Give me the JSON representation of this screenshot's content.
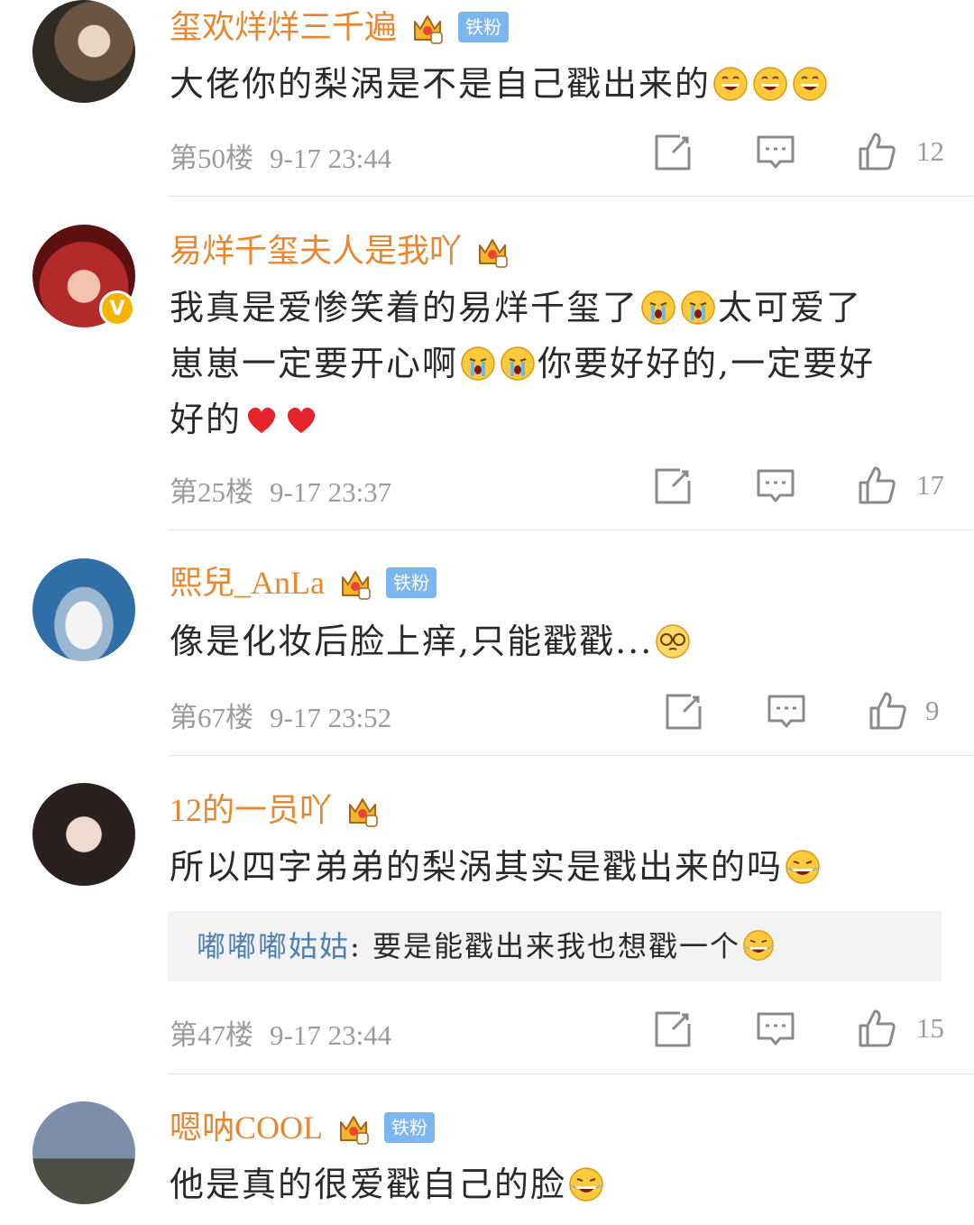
{
  "comments": [
    {
      "username": "玺欢烊烊三千遍",
      "badge": "铁粉",
      "text": "大佬你的梨涡是不是自己戳出来的",
      "emojis": [
        "grin-emoji",
        "grin-emoji",
        "grin-emoji"
      ],
      "floor": "第50楼",
      "time": "9-17 23:44",
      "likes": "12"
    },
    {
      "username": "易烊千玺夫人是我吖",
      "line1": "我真是爱惨笑着的易烊千玺了",
      "line1_tail": "太可爱了",
      "line2": "崽崽一定要开心啊",
      "line2_tail": "你要好好的,一定要好",
      "line3": "好的",
      "floor": "第25楼",
      "time": "9-17 23:37",
      "likes": "17"
    },
    {
      "username": "熙兒_AnLa",
      "badge": "铁粉",
      "text": "像是化妆后脸上痒,只能戳戳...",
      "floor": "第67楼",
      "time": "9-17 23:52",
      "likes": "9"
    },
    {
      "username": "12的一员吖",
      "text": "所以四字弟弟的梨涡其实是戳出来的吗",
      "reply_name": "嘟嘟嘟姑姑",
      "reply_text": ": 要是能戳出来我也想戳一个",
      "floor": "第47楼",
      "time": "9-17 23:44",
      "likes": "15"
    },
    {
      "username": "嗯呐COOL",
      "badge": "铁粉",
      "text": "他是真的很爱戳自己的脸"
    }
  ],
  "colors": {
    "username": "#e8872f",
    "meta": "#9b9b9b",
    "reply_name": "#4f7fb0",
    "fan_badge": "#7bb7ee"
  }
}
